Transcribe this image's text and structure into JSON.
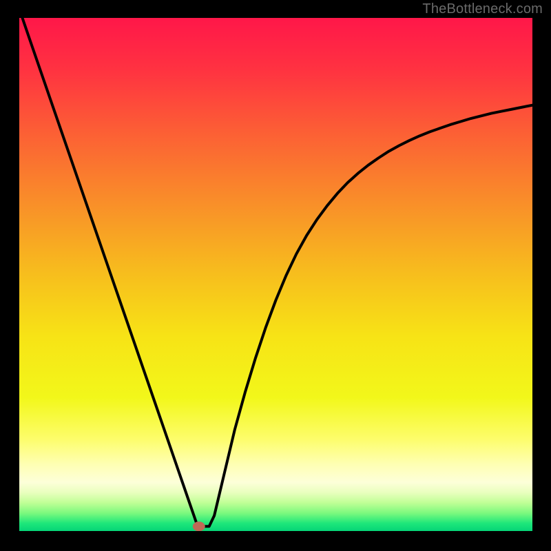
{
  "watermark": "TheBottleneck.com",
  "chart_data": {
    "type": "line",
    "title": "",
    "xlabel": "",
    "ylabel": "",
    "xlim": [
      0,
      100
    ],
    "ylim": [
      0,
      100
    ],
    "x": [
      0.6,
      2,
      4,
      6,
      8,
      10,
      12,
      14,
      16,
      18,
      20,
      22,
      24,
      26,
      28,
      30,
      31,
      32,
      33,
      34,
      34.5,
      35,
      36,
      37,
      38,
      39,
      40,
      41,
      42,
      44,
      46,
      48,
      50,
      52,
      54,
      56,
      58,
      60,
      62,
      64,
      66,
      68,
      70,
      72,
      74,
      76,
      78,
      80,
      82,
      84,
      86,
      88,
      90,
      92,
      94,
      96,
      98,
      100
    ],
    "values": [
      100,
      95.9,
      90.1,
      84.3,
      78.5,
      72.7,
      66.9,
      61.1,
      55.3,
      49.5,
      43.7,
      37.9,
      32.1,
      26.3,
      20.5,
      14.7,
      11.8,
      8.9,
      6.0,
      3.1,
      1.65,
      0.9,
      0.9,
      0.9,
      3.0,
      7.2,
      11.4,
      15.6,
      19.8,
      27.0,
      33.6,
      39.6,
      45.0,
      49.8,
      54.0,
      57.6,
      60.7,
      63.4,
      65.8,
      67.9,
      69.7,
      71.3,
      72.7,
      74.0,
      75.1,
      76.1,
      77.0,
      77.8,
      78.5,
      79.2,
      79.8,
      80.4,
      80.9,
      81.4,
      81.8,
      82.2,
      82.6,
      83.0
    ],
    "marker": {
      "x": 35,
      "y": 0.9,
      "color": "#bf6a56"
    },
    "background_gradient": [
      {
        "offset": 0.0,
        "color": "#ff1749"
      },
      {
        "offset": 0.1,
        "color": "#ff3241"
      },
      {
        "offset": 0.22,
        "color": "#fc5e35"
      },
      {
        "offset": 0.35,
        "color": "#f98b2a"
      },
      {
        "offset": 0.5,
        "color": "#f7be1d"
      },
      {
        "offset": 0.62,
        "color": "#f7e316"
      },
      {
        "offset": 0.74,
        "color": "#f2f71a"
      },
      {
        "offset": 0.82,
        "color": "#fdfd6a"
      },
      {
        "offset": 0.87,
        "color": "#feffb3"
      },
      {
        "offset": 0.905,
        "color": "#fdffd9"
      },
      {
        "offset": 0.925,
        "color": "#e9ffbe"
      },
      {
        "offset": 0.945,
        "color": "#c0ff96"
      },
      {
        "offset": 0.965,
        "color": "#7cf97e"
      },
      {
        "offset": 0.985,
        "color": "#1ee77a"
      },
      {
        "offset": 1.0,
        "color": "#06d577"
      }
    ]
  }
}
